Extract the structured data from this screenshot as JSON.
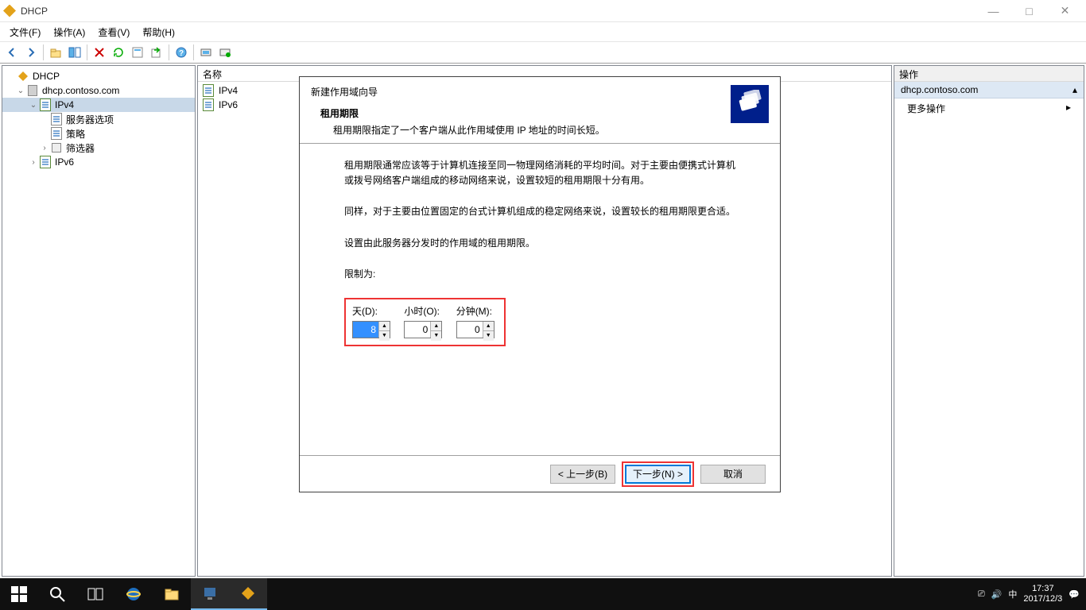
{
  "window": {
    "title": "DHCP"
  },
  "menu": {
    "file": "文件(F)",
    "action": "操作(A)",
    "view": "查看(V)",
    "help": "帮助(H)"
  },
  "tree": {
    "root": "DHCP",
    "server": "dhcp.contoso.com",
    "ipv4": "IPv4",
    "server_options": "服务器选项",
    "policies": "策略",
    "filters": "筛选器",
    "ipv6": "IPv6"
  },
  "center": {
    "col_name": "名称",
    "items": [
      "IPv4",
      "IPv6"
    ]
  },
  "right": {
    "header": "操作",
    "section": "dhcp.contoso.com",
    "more": "更多操作"
  },
  "wizard": {
    "title": "新建作用域向导",
    "subtitle": "租用期限",
    "subdesc": "租用期限指定了一个客户端从此作用域使用 IP 地址的时间长短。",
    "para1": "租用期限通常应该等于计算机连接至同一物理网络消耗的平均时间。对于主要由便携式计算机或拨号网络客户端组成的移动网络来说，设置较短的租用期限十分有用。",
    "para2": "同样，对于主要由位置固定的台式计算机组成的稳定网络来说，设置较长的租用期限更合适。",
    "para3": "设置由此服务器分发时的作用域的租用期限。",
    "limit_label": "限制为:",
    "days_label": "天(D):",
    "hours_label": "小时(O):",
    "minutes_label": "分钟(M):",
    "days_value": "8",
    "hours_value": "0",
    "minutes_value": "0",
    "back": "< 上一步(B)",
    "next": "下一步(N) >",
    "cancel": "取消"
  },
  "taskbar": {
    "time": "17:37",
    "date": "2017/12/3",
    "ime": "中"
  }
}
